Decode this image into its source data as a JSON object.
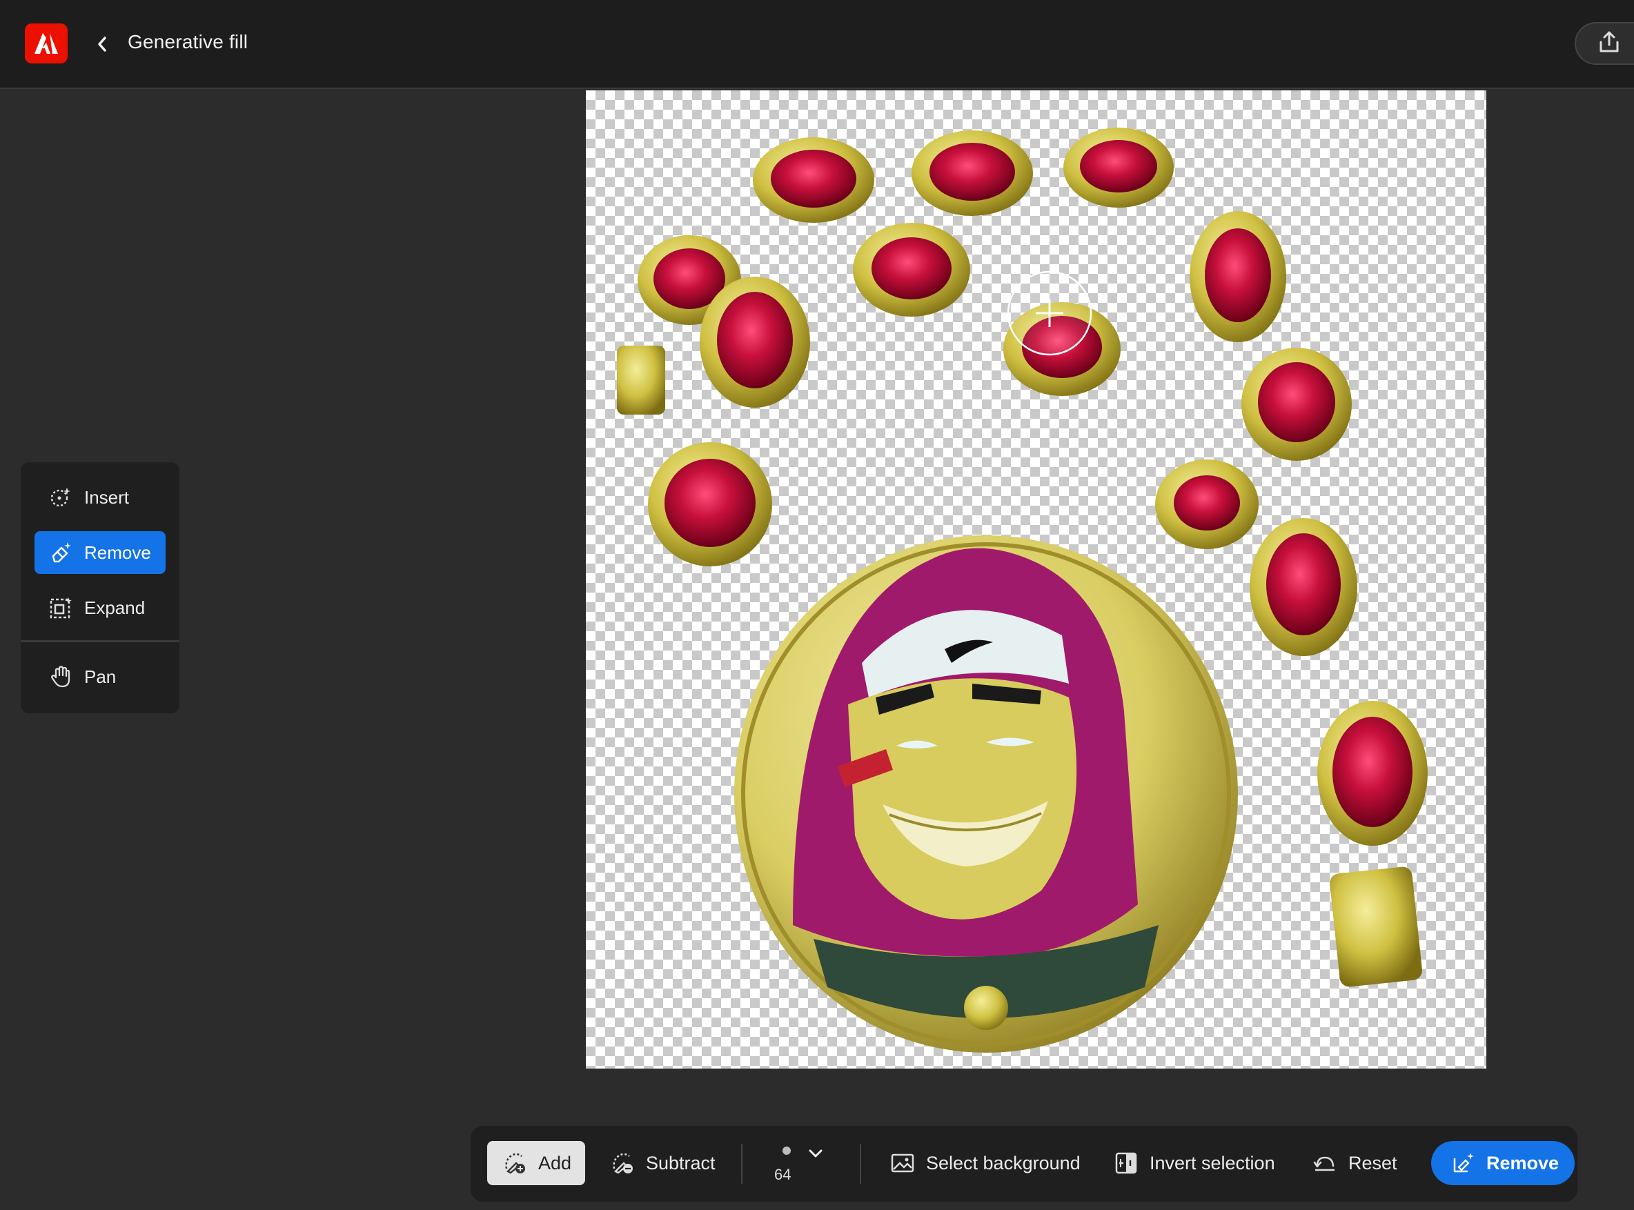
{
  "header": {
    "title": "Generative fill"
  },
  "tools": {
    "insert": "Insert",
    "remove": "Remove",
    "expand": "Expand",
    "pan": "Pan",
    "active": "remove"
  },
  "toolbar": {
    "add": "Add",
    "subtract": "Subtract",
    "brush_size": "64",
    "select_background": "Select background",
    "invert_selection": "Invert selection",
    "reset": "Reset",
    "remove": "Remove"
  },
  "colors": {
    "accent": "#1473e6",
    "brand": "#eb1000",
    "ruby": "#b0123b",
    "gold": "#cdbf3a"
  }
}
